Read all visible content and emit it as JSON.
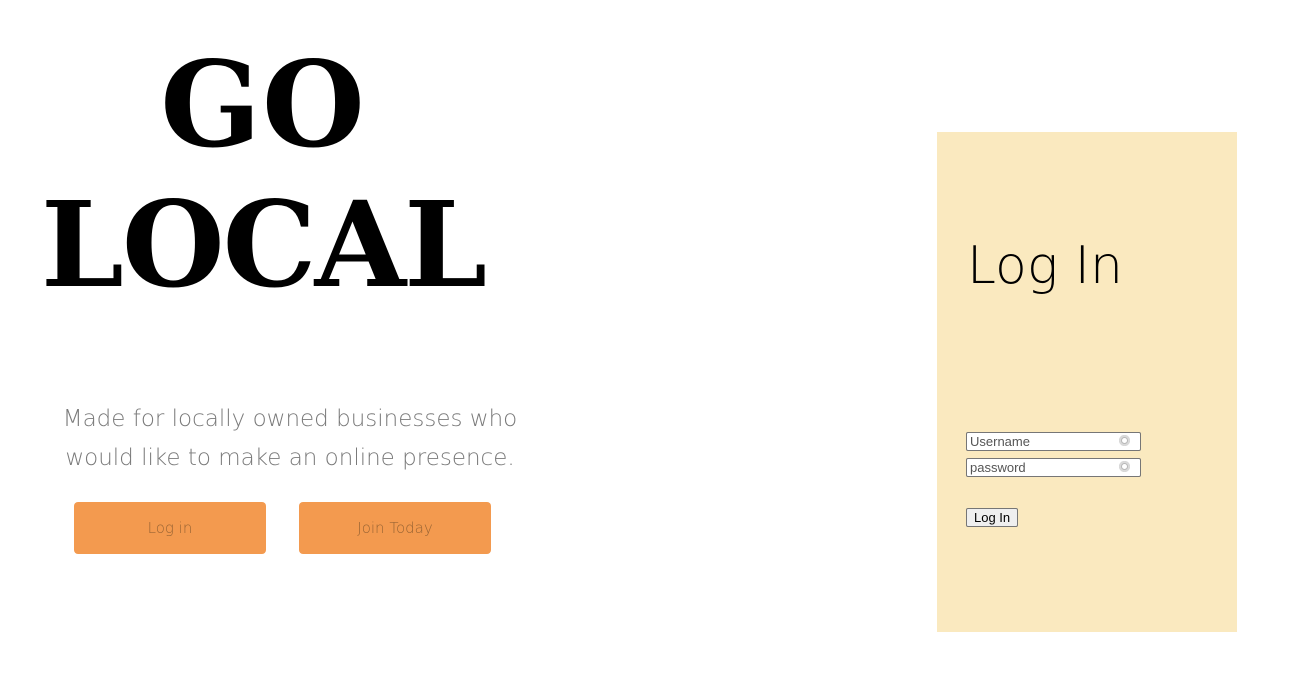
{
  "hero": {
    "brand_line1": "GO",
    "brand_line2": "LOCAL",
    "tagline": "Made for locally owned businesses who would like to make an online presence.",
    "login_button": "Log in",
    "join_button": "Join Today",
    "accent_color": "#f39a4f"
  },
  "login_panel": {
    "title": "Log In",
    "background_color": "#fae9bf",
    "username_placeholder": "Username",
    "password_placeholder": "password",
    "username_icon": "password-manager-key-icon",
    "password_icon": "password-manager-key-icon",
    "submit_label": "Log In"
  }
}
